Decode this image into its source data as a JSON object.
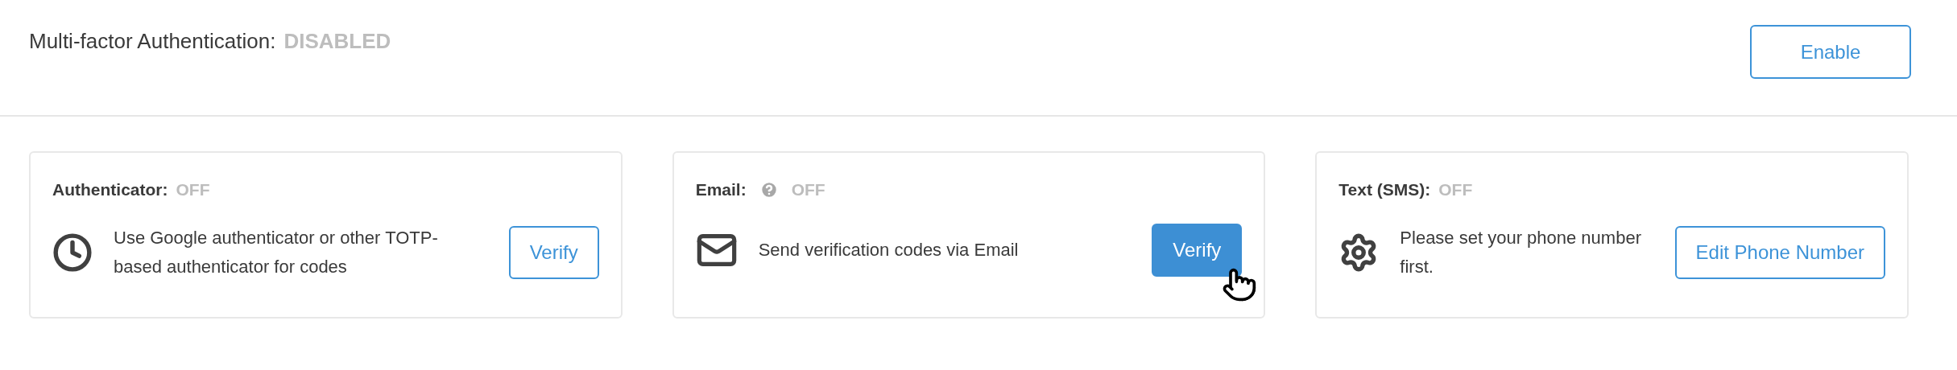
{
  "header": {
    "title": "Multi-factor Authentication:",
    "status": "DISABLED",
    "button": "Enable"
  },
  "methods": [
    {
      "title": "Authenticator:",
      "help_icon": false,
      "status": "OFF",
      "description": "Use Google authenticator or other TOTP-based authenticator for codes",
      "button": {
        "label": "Verify",
        "kind": "outline"
      }
    },
    {
      "title": "Email:",
      "help_icon": true,
      "status": "OFF",
      "description": "Send verification codes via Email",
      "button": {
        "label": "Verify",
        "kind": "filled"
      }
    },
    {
      "title": "Text (SMS):",
      "help_icon": false,
      "status": "OFF",
      "description": "Please set your phone number first.",
      "button": {
        "label": "Edit Phone Number",
        "kind": "outline"
      }
    }
  ]
}
